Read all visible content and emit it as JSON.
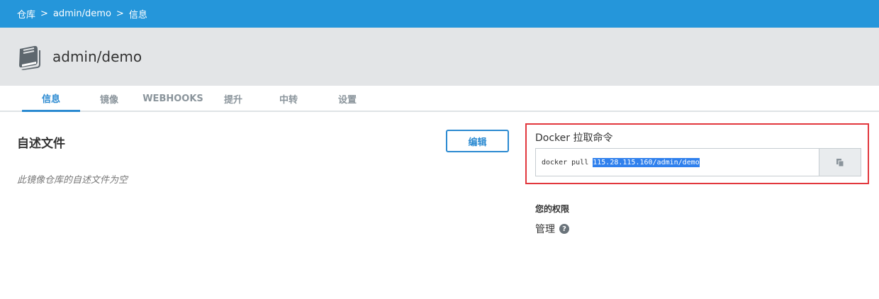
{
  "breadcrumb": {
    "items": [
      "仓库",
      "admin/demo",
      "信息"
    ],
    "separator": ">"
  },
  "repo": {
    "title": "admin/demo",
    "icon": "book-stack-icon"
  },
  "tabs": [
    {
      "label": "信息",
      "active": true
    },
    {
      "label": "镜像",
      "active": false
    },
    {
      "label": "WEBHOOKS",
      "active": false
    },
    {
      "label": "提升",
      "active": false
    },
    {
      "label": "中转",
      "active": false
    },
    {
      "label": "设置",
      "active": false
    }
  ],
  "readme": {
    "title": "自述文件",
    "empty_text": "此镜像仓库的自述文件为空",
    "edit_label": "编辑"
  },
  "pull": {
    "label": "Docker 拉取命令",
    "command_prefix": "docker pull ",
    "command_target": "115.28.115.160/admin/demo",
    "copy_icon": "copy-icon"
  },
  "permissions": {
    "title": "您的权限",
    "value": "管理",
    "help_icon": "question-circle-icon",
    "help_glyph": "?"
  },
  "colors": {
    "topbar": "#2596da",
    "accent": "#2b8ad1",
    "highlight_box": "#e2373d"
  }
}
